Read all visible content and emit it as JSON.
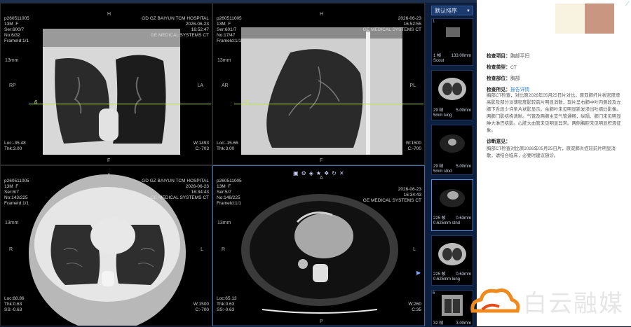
{
  "viewports": {
    "coronal": {
      "tl": [
        "p260511005",
        "13M  F",
        "Ser:600/7",
        "No:6/32",
        "FrameId:1/1"
      ],
      "tr": [
        "GD GZ BAIYUN TCM HOSPITAL",
        "2026-06-23",
        "16:52:47",
        "GE MEDICAL SYSTEMS CT"
      ],
      "bl": [
        "Loc:-35.48",
        "Thk:3.00"
      ],
      "br": [
        "W:1493",
        "C:-703"
      ],
      "scale": "13mm",
      "left_marker": "RP",
      "right_marker": "LA",
      "top_marker": "H",
      "bottom_marker": "F",
      "line_label": "6"
    },
    "sagittal": {
      "tl": [
        "p260511005",
        "13M  F",
        "Ser:601/7",
        "No:17/47",
        "FrameId:1/1"
      ],
      "tr": [
        "2026-06-23",
        "16:52:55",
        "GE MEDICAL SYSTEMS CT"
      ],
      "bl": [
        "Loc:-15.66",
        "Thk:3.00"
      ],
      "br": [
        "W:1500",
        "C:-700"
      ],
      "scale": "13mm",
      "left_marker": "AR",
      "right_marker": "PL",
      "top_marker": "H",
      "bottom_marker": "F",
      "line_label": "17"
    },
    "axial_lung": {
      "tl": [
        "p260511005",
        "13M  F",
        "Ser:6/7",
        "No:143/225",
        "FrameId:1/1"
      ],
      "tr": [
        "GD GZ BAIYUN TCM HOSPITAL",
        "2026-06-23",
        "16:34:43",
        "GE MEDICAL SYSTEMS CT"
      ],
      "bl": [
        "Loc:68.86",
        "Thk:0.63",
        "SS:-0.63"
      ],
      "br": [
        "W:1500",
        "C:-700"
      ],
      "scale": "13mm",
      "left_marker": "R",
      "right_marker": "L",
      "top_marker": "A",
      "bottom_marker": "P"
    },
    "axial_mediastinum": {
      "tl": [
        "p260511005",
        "13M  F",
        "Ser:5/7",
        "No:148/225",
        "FrameId:1/1"
      ],
      "tr": [
        "2026-06-23",
        "16:34:43",
        "GE MEDICAL SYSTEMS CT"
      ],
      "bl": [
        "Loc:65.13",
        "Thk:0.63",
        "SS:-0.63"
      ],
      "br": [
        "W:260",
        "C:35"
      ],
      "scale": "13mm",
      "left_marker": "R",
      "right_marker": "L",
      "top_marker": "A",
      "bottom_marker": "P",
      "toolbar_icons": [
        "image-icon",
        "gear-icon",
        "3d-icon",
        "star-icon",
        "stack-icon",
        "refresh-icon",
        "close-icon"
      ]
    }
  },
  "sidebar": {
    "sort_label": "默认排序",
    "thumbnails": [
      {
        "num": "1",
        "count": "1 帧",
        "thk": "133.00mm",
        "desc": "Scout"
      },
      {
        "num": "2",
        "count": "29 帧",
        "thk": "5.00mm",
        "desc": "5mm lung"
      },
      {
        "num": "3",
        "count": "29 帧",
        "thk": "5.00mm",
        "desc": "5mm stnd"
      },
      {
        "num": "4",
        "count": "225 帧",
        "thk": "0.63mm",
        "desc": "0.625mm stnd"
      },
      {
        "num": "5",
        "count": "225 帧",
        "thk": "0.63mm",
        "desc": "0.625mm lung"
      },
      {
        "num": "6",
        "count": "32 帧",
        "thk": "3.00mm",
        "desc": ""
      }
    ]
  },
  "report": {
    "item_label": "检查项目：",
    "item_value": "胸部平扫",
    "type_label": "检查类型：",
    "type_value": "CT",
    "part_label": "检查部位：",
    "part_value": "胸部",
    "findings_label": "检查所见：",
    "findings_link": "报告详情",
    "findings_text": "胸部CT检查，对比原2026年05月25日片对比，原双肺纤片状密度增高影及部分淡薄密度影较前片明显消散，现片呈右肺中叶内侧段及左肺下舌段少许条片状影显示。余肺叶未见明显新发渗出吐病灶影像。两肺门影结构清晰。气管及两肺主支气管通畅，纵隔、肺门未见明显肿大淋巴结影。心脏大血管未见明显异常。两侧胸腔未见明显积液征象。",
    "impression_label": "诊断意见：",
    "impression_text": "胸部CT检查对比原2026年05月25日片，原双肺炎症较前片明显消散，请结合临床，必要时建议随诊。",
    "brand": "白云融媒",
    "colors": {
      "swatch1": "#f8f3e0",
      "swatch2": "#c99682",
      "accent": "#2f7fe0"
    }
  }
}
